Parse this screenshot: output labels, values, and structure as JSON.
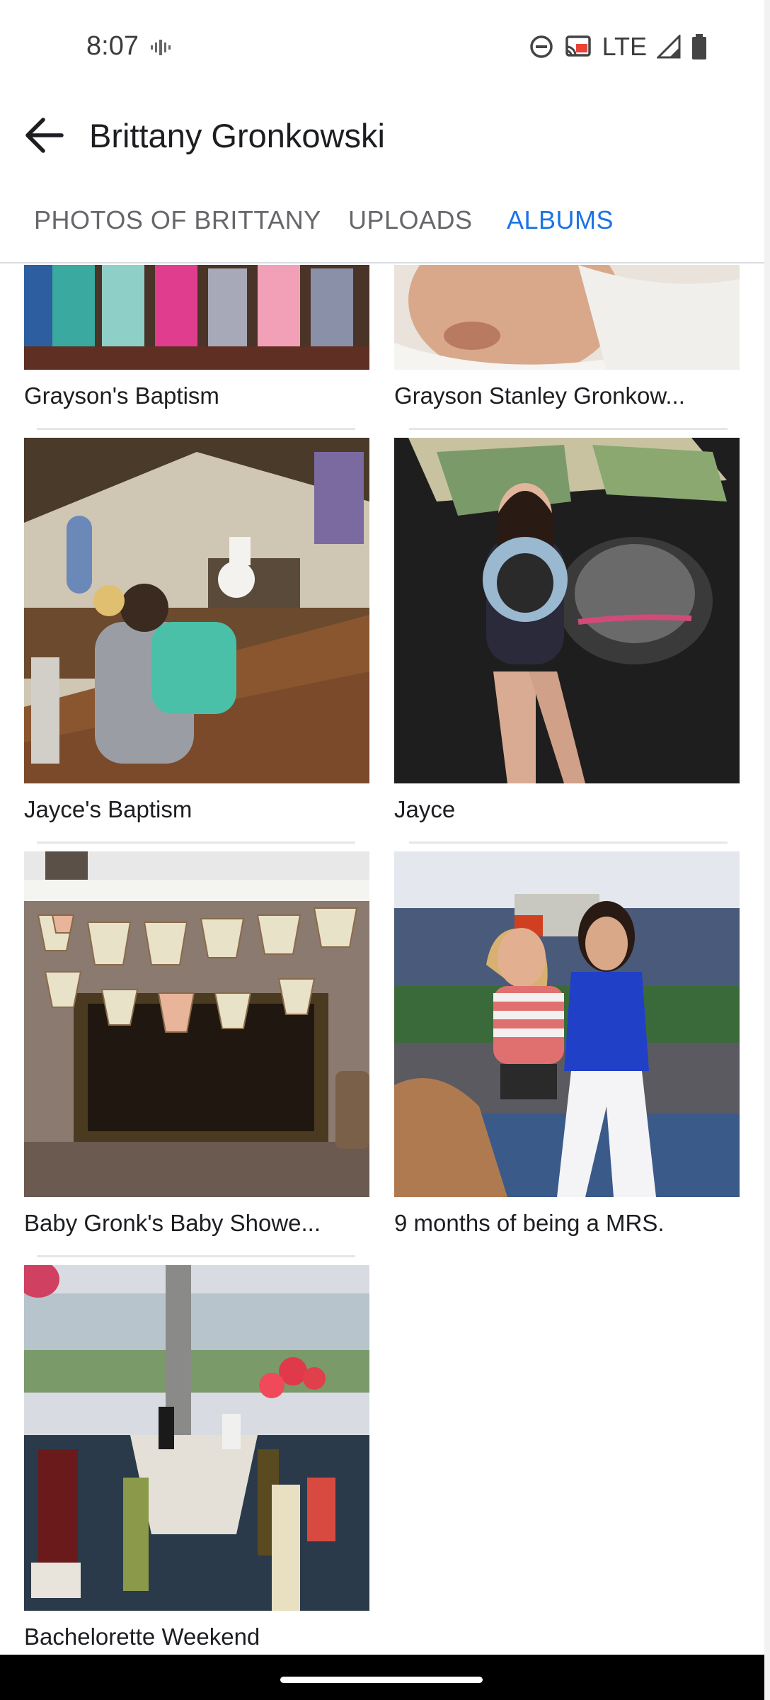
{
  "status_bar": {
    "time": "8:07",
    "network": "LTE",
    "icons": [
      "vibrate-icon",
      "do-not-disturb-icon",
      "cast-icon",
      "signal-icon",
      "battery-icon"
    ]
  },
  "app_bar": {
    "back_icon": "arrow-left-icon",
    "title": "Brittany Gronkowski"
  },
  "tabs": [
    {
      "label": "PHOTOS OF BRITTANY",
      "active": false
    },
    {
      "label": "UPLOADS",
      "active": false
    },
    {
      "label": "ALBUMS",
      "active": true
    }
  ],
  "colors": {
    "accent": "#1b74e4",
    "tab_inactive": "#65676b",
    "text": "#1c1e21",
    "divider": "#e4e6eb"
  },
  "albums": [
    {
      "title": "Grayson's Baptism"
    },
    {
      "title": "Grayson Stanley Gronkow..."
    },
    {
      "title": "Jayce's Baptism"
    },
    {
      "title": "Jayce"
    },
    {
      "title": "Baby Gronk's Baby Showe..."
    },
    {
      "title": "9 months of being a MRS."
    },
    {
      "title": "Bachelorette Weekend"
    }
  ]
}
